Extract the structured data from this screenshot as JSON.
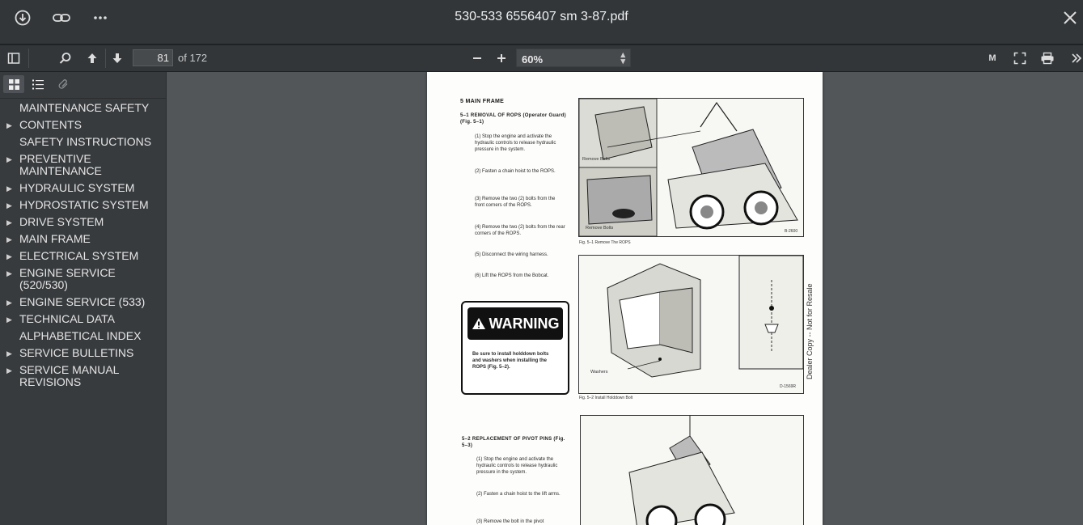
{
  "titlebar": {
    "title": "530-533 6556407 sm 3-87.pdf",
    "icons": [
      "download-icon",
      "link-icon",
      "more-icon",
      "close-icon"
    ]
  },
  "toolbar": {
    "page_current": "81",
    "page_total": "of 172",
    "zoom": "60%",
    "right_label": "M"
  },
  "sidebar": {
    "items": [
      {
        "label": "MAINTENANCE SAFETY",
        "expandable": false
      },
      {
        "label": "CONTENTS",
        "expandable": true
      },
      {
        "label": "SAFETY INSTRUCTIONS",
        "expandable": false
      },
      {
        "label": "PREVENTIVE MAINTENANCE",
        "expandable": true
      },
      {
        "label": "HYDRAULIC SYSTEM",
        "expandable": true
      },
      {
        "label": "HYDROSTATIC SYSTEM",
        "expandable": true
      },
      {
        "label": "DRIVE SYSTEM",
        "expandable": true
      },
      {
        "label": "MAIN FRAME",
        "expandable": true
      },
      {
        "label": "ELECTRICAL SYSTEM",
        "expandable": true
      },
      {
        "label": "ENGINE SERVICE (520/530)",
        "expandable": true
      },
      {
        "label": "ENGINE SERVICE (533)",
        "expandable": true
      },
      {
        "label": "TECHNICAL DATA",
        "expandable": true
      },
      {
        "label": "ALPHABETICAL INDEX",
        "expandable": false
      },
      {
        "label": "SERVICE BULLETINS",
        "expandable": true
      },
      {
        "label": "SERVICE MANUAL REVISIONS",
        "expandable": true
      }
    ]
  },
  "page": {
    "section": "5 MAIN FRAME",
    "sub1": "5–1  REMOVAL OF ROPS (Operator Guard) (Fig. 5–1)",
    "steps1": [
      "(1)  Stop the engine and activate the hydraulic controls to release hydraulic pressure in the system.",
      "(2)  Fasten a chain hoist to the ROPS.",
      "(3)  Remove the two (2) bolts from the front corners of the ROPS.",
      "(4)  Remove the two (2) bolts from the rear corners of the ROPS.",
      "(5)  Disconnect the wiring harness.",
      "(6)  Lift the ROPS from the Bobcat."
    ],
    "warning_title": "WARNING",
    "warning_text": "Be sure to install holddown bolts and washers when installing the ROPS (Fig. 5–2).",
    "sub2": "5–2  REPLACEMENT OF PIVOT PINS (Fig. 5–3)",
    "steps2": [
      "(1)  Stop the engine and activate the hydraulic controls to release hydraulic pressure in the system.",
      "(2)  Fasten a chain hoist to the lift arms.",
      "(3)  Remove the bolt in the pivot"
    ],
    "fig1_caption": "Fig. 5–1    Remove The ROPS",
    "fig1_label_a": "Remove Bolts",
    "fig1_label_b": "Remove Bolts",
    "fig1_code": "B-2600",
    "fig2_caption": "Fig. 5–2    Install Holddown Bolt",
    "fig2_label": "Washers",
    "fig2_code": "D-1569R",
    "watermark": "Dealer Copy -- Not for Resale"
  }
}
